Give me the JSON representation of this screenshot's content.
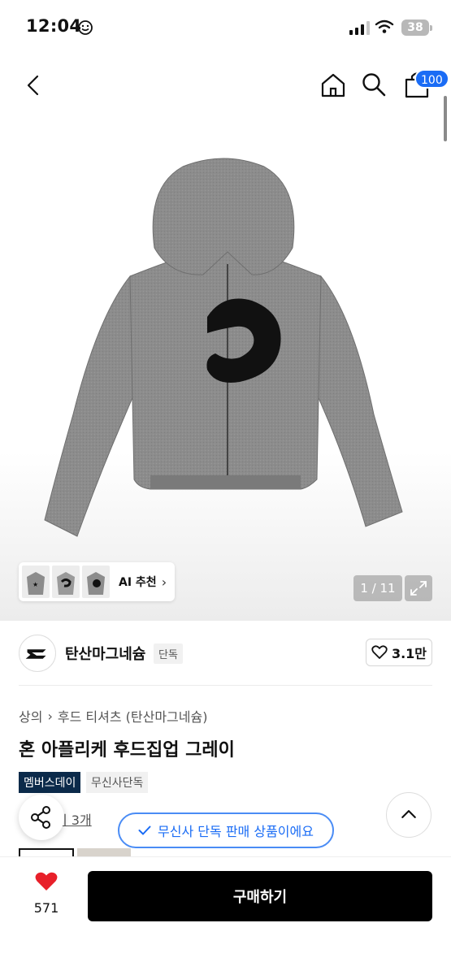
{
  "status_bar": {
    "time": "12:04",
    "battery": "38"
  },
  "header": {
    "cart_count": "100"
  },
  "gallery": {
    "counter": "1 / 11",
    "ai_recommend_label": "AI 추천"
  },
  "brand": {
    "name": "탄산마그네슘",
    "tag": "단독",
    "likes": "3.1만"
  },
  "product": {
    "breadcrumb": [
      "상의",
      "후드 티셔츠 (탄산마그네슘)"
    ],
    "title": "혼 아플리케 후드집업 그레이",
    "badges": [
      "멤버스데이",
      "무신사단독"
    ],
    "review_link": "기 3개",
    "exclusive_notice": "무신사 단독 판매 상품이에요"
  },
  "bottom_bar": {
    "like_count": "571",
    "buy_label": "구매하기"
  },
  "colors": {
    "accent": "#1a6cf5",
    "heart": "#e8202a",
    "member_badge": "#0b2a4a",
    "hoodie": "#8c8c8c"
  },
  "icons": [
    "back-icon",
    "home-icon",
    "search-icon",
    "cart-icon",
    "expand-icon",
    "heart-icon",
    "share-icon",
    "chevron-up-icon",
    "check-icon"
  ]
}
